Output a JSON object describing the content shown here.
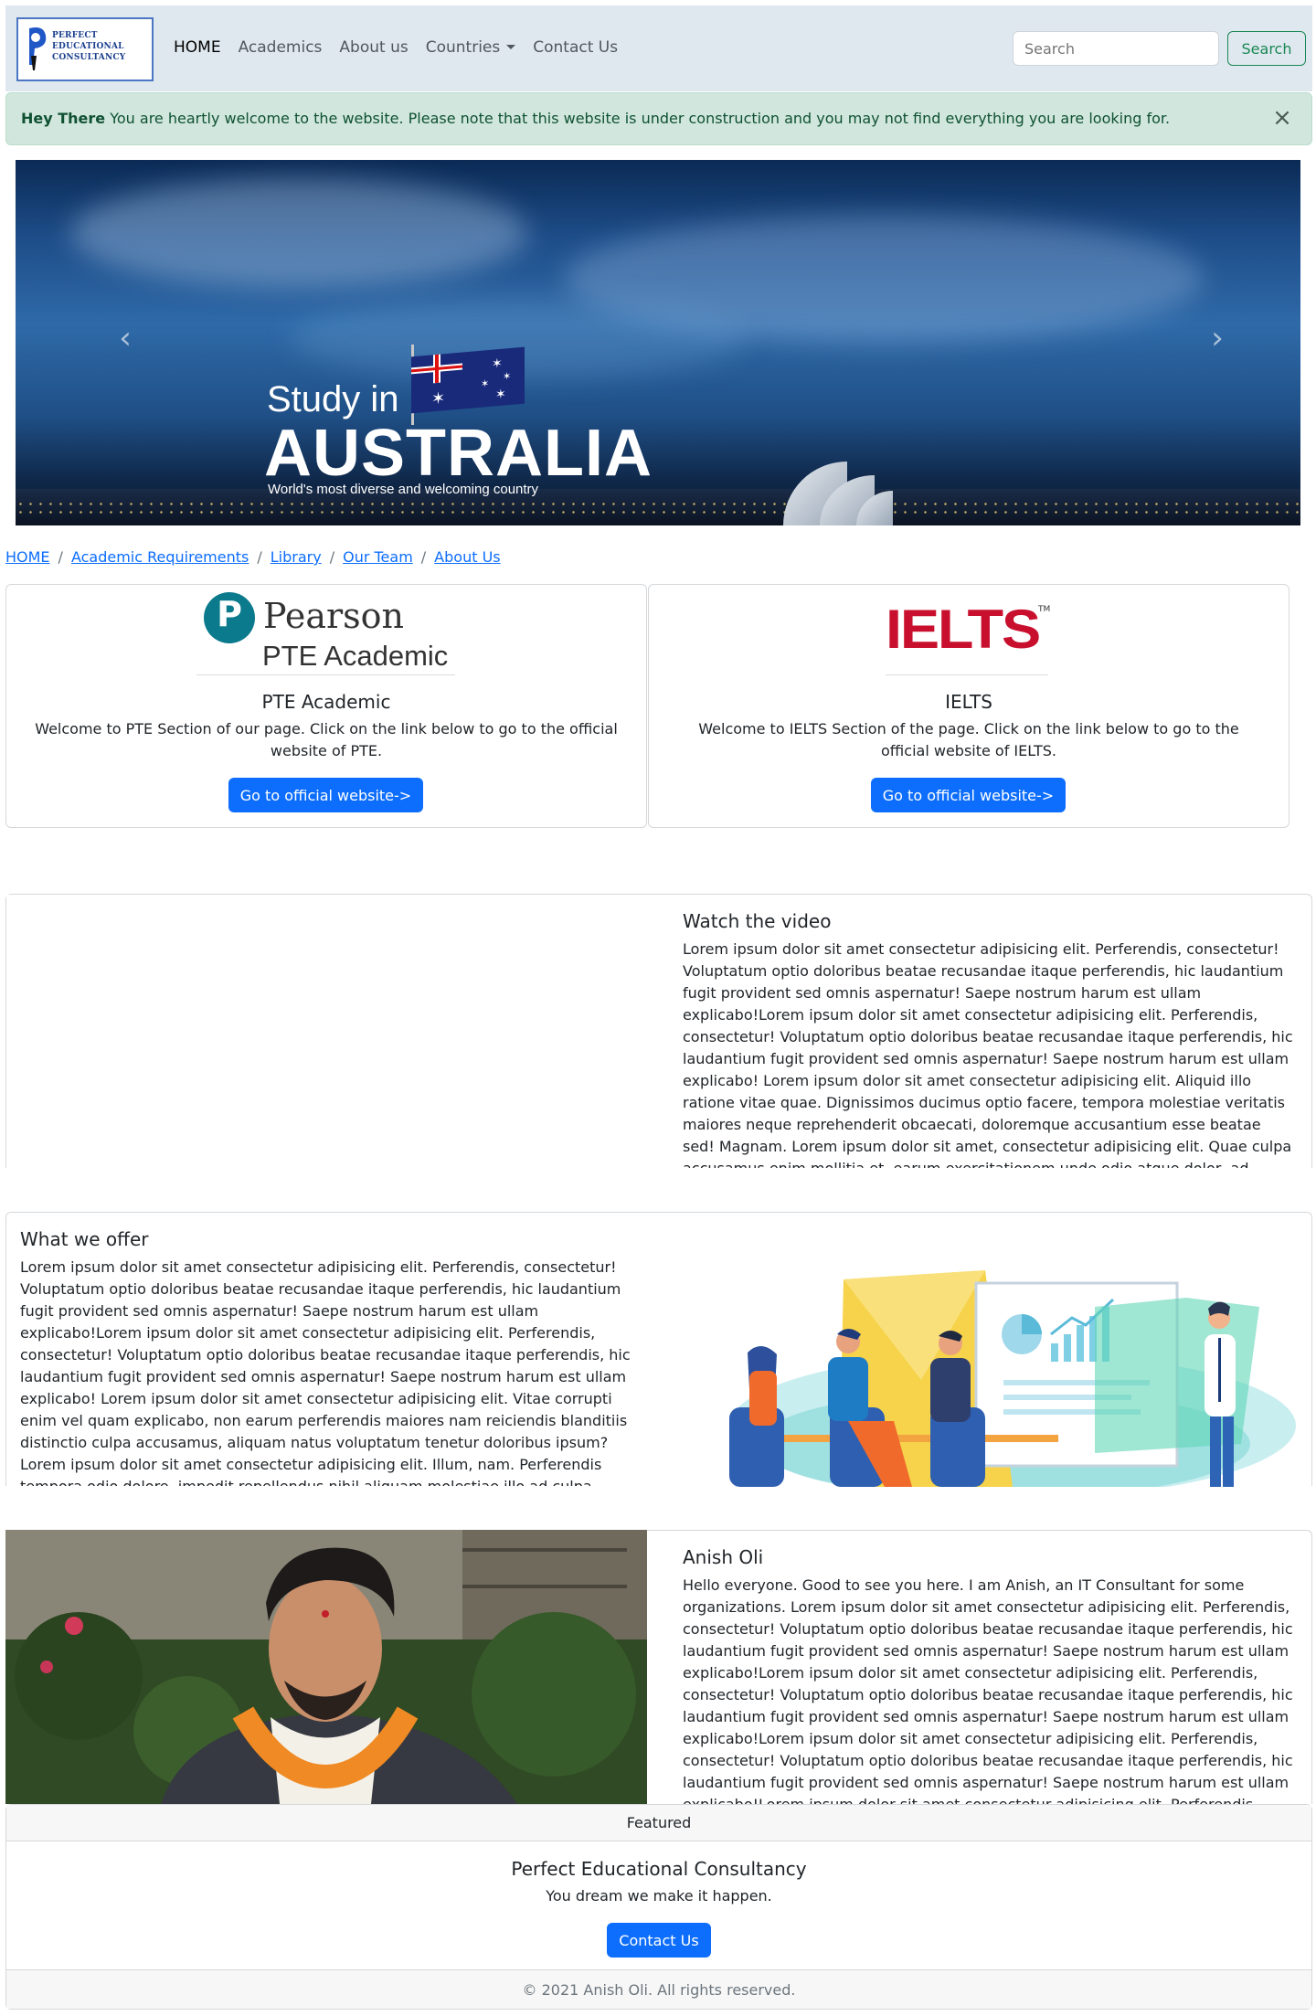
{
  "brand": {
    "logo_line1": "PERFECT",
    "logo_line2": "EDUCATIONAL",
    "logo_line3": "CONSULTANCY"
  },
  "nav": {
    "home": "HOME",
    "academics": "Academics",
    "about": "About us",
    "countries": "Countries",
    "contact": "Contact Us",
    "search_placeholder": "Search",
    "search_button": "Search"
  },
  "alert": {
    "strong": "Hey There",
    "message": "You are heartly welcome to the website. Please note that this website is under construction and you may not find everything you are looking for.",
    "close": "×"
  },
  "carousel": {
    "line1": "Study in",
    "line2": "AUSTRALIA",
    "line3": "World's most diverse and welcoming country",
    "prev": "‹",
    "next": "›"
  },
  "breadcrumb": [
    "HOME",
    "Academic Requirements",
    "Library",
    "Our Team",
    "About Us"
  ],
  "breadcrumb_sep": "/",
  "cards": [
    {
      "logo_word": "Pearson",
      "logo_sub": "PTE Academic",
      "logo_letter": "P",
      "title": "PTE Academic",
      "text": "Welcome to PTE Section of our page. Click on the link below to go to the official website of PTE.",
      "button": "Go to official website->"
    },
    {
      "logo_word": "IELTS",
      "logo_tm": "TM",
      "title": "IELTS",
      "text": "Welcome to IELTS Section of the page. Click on the link below to go to the official website of IELTS.",
      "button": "Go to official website->"
    }
  ],
  "video_section": {
    "title": "Watch the video",
    "text": "Lorem ipsum dolor sit amet consectetur adipisicing elit. Perferendis, consectetur! Voluptatum optio doloribus beatae recusandae itaque perferendis, hic laudantium fugit provident sed omnis aspernatur! Saepe nostrum harum est ullam explicabo!Lorem ipsum dolor sit amet consectetur adipisicing elit. Perferendis, consectetur! Voluptatum optio doloribus beatae recusandae itaque perferendis, hic laudantium fugit provident sed omnis aspernatur! Saepe nostrum harum est ullam explicabo! Lorem ipsum dolor sit amet consectetur adipisicing elit. Aliquid illo ratione vitae quae. Dignissimos ducimus optio facere, tempora molestiae veritatis maiores neque reprehenderit obcaecati, doloremque accusantium esse beatae sed! Magnam. Lorem ipsum dolor sit amet, consectetur adipisicing elit. Quae culpa accusamus enim mollitia et, earum exercitationem unde odio atque dolor, ad."
  },
  "offer_section": {
    "title": "What we offer",
    "text": "Lorem ipsum dolor sit amet consectetur adipisicing elit. Perferendis, consectetur! Voluptatum optio doloribus beatae recusandae itaque perferendis, hic laudantium fugit provident sed omnis aspernatur! Saepe nostrum harum est ullam explicabo!Lorem ipsum dolor sit amet consectetur adipisicing elit. Perferendis, consectetur! Voluptatum optio doloribus beatae recusandae itaque perferendis, hic laudantium fugit provident sed omnis aspernatur! Saepe nostrum harum est ullam explicabo! Lorem ipsum dolor sit amet consectetur adipisicing elit. Vitae corrupti enim vel quam explicabo, non earum perferendis maiores nam reiciendis blanditiis distinctio culpa accusamus, aliquam natus voluptatum tenetur doloribus ipsum? Lorem ipsum dolor sit amet consectetur adipisicing elit. Illum, nam. Perferendis tempora odio dolore, impedit repellendus nihil aliquam molestiae illo ad culpa."
  },
  "profile_section": {
    "name": "Anish Oli",
    "text": "Hello everyone. Good to see you here. I am Anish, an IT Consultant for some organizations. Lorem ipsum dolor sit amet consectetur adipisicing elit. Perferendis, consectetur! Voluptatum optio doloribus beatae recusandae itaque perferendis, hic laudantium fugit provident sed omnis aspernatur! Saepe nostrum harum est ullam explicabo!Lorem ipsum dolor sit amet consectetur adipisicing elit. Perferendis, consectetur! Voluptatum optio doloribus beatae recusandae itaque perferendis, hic laudantium fugit provident sed omnis aspernatur! Saepe nostrum harum est ullam explicabo!Lorem ipsum dolor sit amet consectetur adipisicing elit. Perferendis, consectetur! Voluptatum optio doloribus beatae recusandae itaque perferendis, hic laudantium fugit provident sed omnis aspernatur! Saepe nostrum harum est ullam explicabo!Lorem ipsum dolor sit amet consectetur adipisicing elit. Perferendis."
  },
  "featured": {
    "header": "Featured",
    "title": "Perfect Educational Consultancy",
    "tagline": "You dream we make it happen.",
    "button": "Contact Us",
    "footer": "© 2021 Anish Oli. All rights reserved."
  },
  "colors": {
    "primary": "#0d6efd",
    "success": "#198754",
    "alert_bg": "#d1e7dd",
    "navbar_bg": "#e0e8ef",
    "ielts_red": "#c8102e",
    "pearson_teal": "#0b7a8c"
  }
}
